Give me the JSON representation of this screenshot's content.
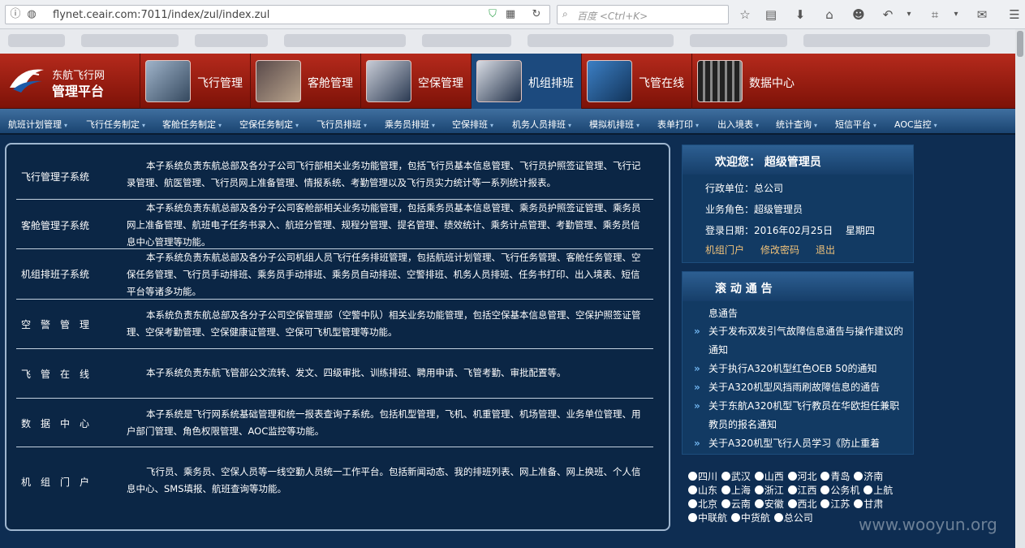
{
  "browser": {
    "url": "flynet.ceair.com:7011/index/zul/index.zul",
    "search_placeholder": "百度 <Ctrl+K>"
  },
  "brand": {
    "line1": "东航飞行网",
    "line2": "管理平台"
  },
  "modules": [
    {
      "label": "飞行管理"
    },
    {
      "label": "客舱管理"
    },
    {
      "label": "空保管理"
    },
    {
      "label": "机组排班"
    },
    {
      "label": "飞管在线"
    },
    {
      "label": "数据中心"
    }
  ],
  "submenu": [
    "航班计划管理",
    "飞行任务制定",
    "客舱任务制定",
    "空保任务制定",
    "飞行员排班",
    "乘务员排班",
    "空保排班",
    "机务人员排班",
    "模拟机排班",
    "表单打印",
    "出入境表",
    "统计查询",
    "短信平台",
    "AOC监控"
  ],
  "subsystems": [
    {
      "name": "飞行管理子系统",
      "desc": "本子系统负责东航总部及各分子公司飞行部相关业务功能管理，包括飞行员基本信息管理、飞行员护照签证管理、飞行记录管理、航医管理、飞行员网上准备管理、情报系统、考勤管理以及飞行员实力统计等一系列统计报表。"
    },
    {
      "name": "客舱管理子系统",
      "desc": "本子系统负责东航总部及各分子公司客舱部相关业务功能管理，包括乘务员基本信息管理、乘务员护照签证管理、乘务员网上准备管理、航班电子任务书录入、航班分管理、规程分管理、提名管理、绩效统计、乘务计点管理、考勤管理、乘务员信息中心管理等功能。"
    },
    {
      "name": "机组排班子系统",
      "desc": "本子系统负责东航总部及各分子公司机组人员飞行任务排班管理，包括航班计划管理、飞行任务管理、客舱任务管理、空保任务管理、飞行员手动排班、乘务员手动排班、乘务员自动排班、空警排班、机务人员排班、任务书打印、出入境表、短信平台等诸多功能。"
    },
    {
      "name": "空　警　管　理",
      "desc": "本系统负责东航总部及各分子公司空保管理部（空警中队）相关业务功能管理，包括空保基本信息管理、空保护照签证管理、空保考勤管理、空保健康证管理、空保可飞机型管理等功能。"
    },
    {
      "name": "飞　管　在　线",
      "desc": "本子系统负责东航飞管部公文流转、发文、四级审批、训练排班、聘用申请、飞管考勤、审批配置等。"
    },
    {
      "name": "数　据　中　心",
      "desc": "本子系统是飞行网系统基础管理和统一报表查询子系统。包括机型管理，飞机、机重管理、机场管理、业务单位管理、用户部门管理、角色权限管理、AOC监控等功能。"
    },
    {
      "name": "机　组　门　户",
      "desc": "飞行员、乘务员、空保人员等一线空勤人员统一工作平台。包括新闻动态、我的排班列表、网上准备、网上换班、个人信息中心、SMS填报、航班查询等功能。"
    }
  ],
  "welcome": {
    "title": "欢迎您： 超级管理员",
    "unit": "行政单位：总公司",
    "role": "业务角色：超级管理员",
    "login_date": "登录日期：2016年02月25日　 星期四",
    "links": [
      "机组门户",
      "修改密码",
      "退出"
    ]
  },
  "notices": {
    "title": "滚 动 通 告",
    "partial": "息通告",
    "items": [
      "关于发布双发引气故障信息通告与操作建议的通知",
      "关于执行A320机型红色OEB 50的通知",
      "关于A320机型风挡雨刷故障信息的通告",
      "关于东航A320机型飞行教员在华欧担任兼职教员的报名通知",
      "关于A320机型飞行人员学习《防止重着"
    ]
  },
  "regions": [
    "四川",
    "武汉",
    "山西",
    "河北",
    "青岛",
    "济南",
    "山东",
    "上海",
    "浙江",
    "江西",
    "公务机",
    "上航",
    "北京",
    "云南",
    "安徽",
    "西北",
    "江苏",
    "甘肃",
    "中联航",
    "中货航",
    "总公司"
  ],
  "watermark": "www.wooyun.org",
  "colors": {
    "header_red": "#b52a1c",
    "page_navy": "#0e2d52",
    "link_gold": "#f0c27a"
  }
}
